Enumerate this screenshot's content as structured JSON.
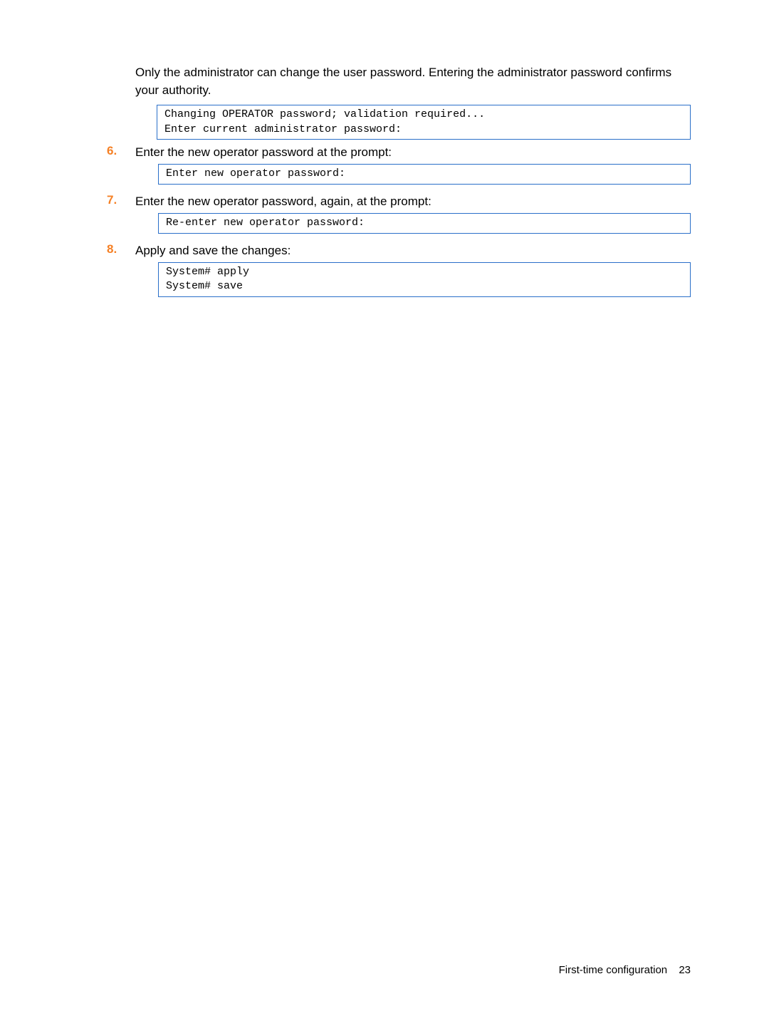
{
  "intro": "Only the administrator can change the user password. Entering the administrator password confirms your authority.",
  "introCode": "Changing OPERATOR password; validation required...\nEnter current administrator password:",
  "steps": [
    {
      "num": "6.",
      "text": "Enter the new operator password at the prompt:",
      "code": "Enter new operator password:"
    },
    {
      "num": "7.",
      "text": "Enter the new operator password, again, at the prompt:",
      "code": "Re-enter new operator password:"
    },
    {
      "num": "8.",
      "text": "Apply and save the changes:",
      "code": "System# apply\nSystem# save"
    }
  ],
  "footer": {
    "label": "First-time configuration",
    "page": "23"
  }
}
